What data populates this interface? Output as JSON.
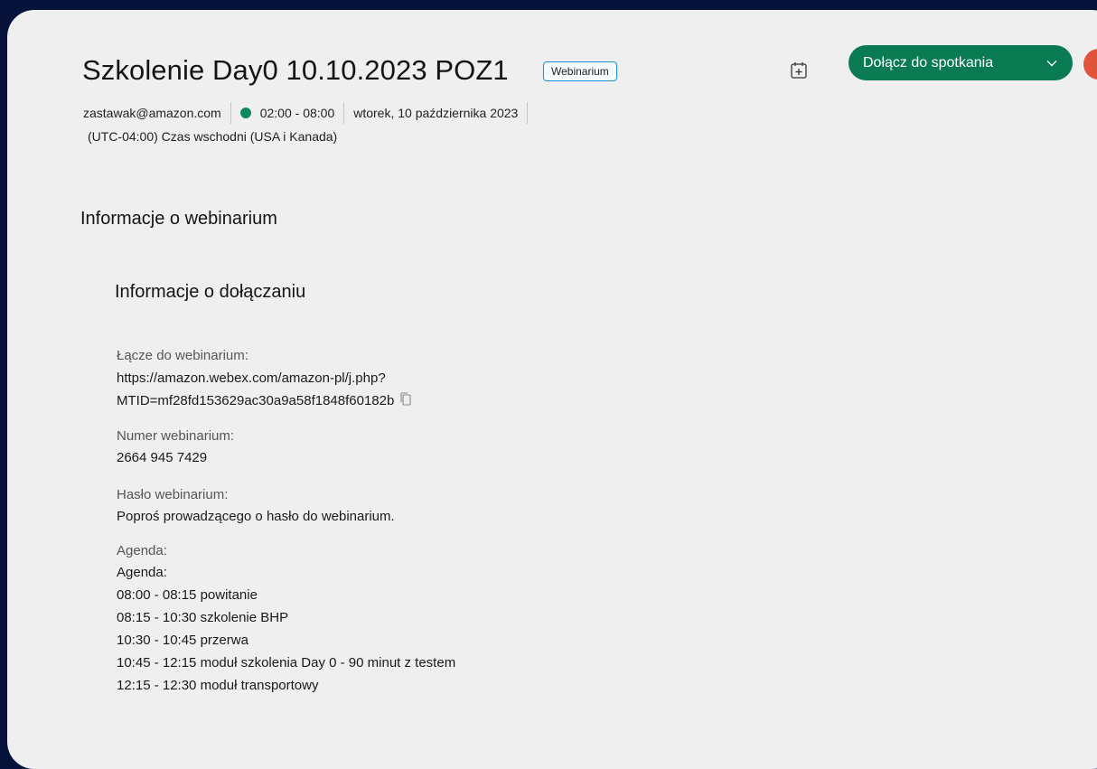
{
  "meeting": {
    "title": "Szkolenie Day0 10.10.2023 POZ1",
    "type_badge": "Webinarium",
    "host_email": "zastawak@amazon.com",
    "time_range": "02:00 - 08:00",
    "date": "wtorek, 10 października 2023",
    "timezone": "(UTC-04:00) Czas wschodni (USA i Kanada)",
    "status_color": "#0a8a5a"
  },
  "actions": {
    "join_label": "Dołącz do spotkania",
    "add_to_calendar_icon": "calendar-add-icon",
    "accent_color": "#0a7a52"
  },
  "sections": {
    "webinar_info_heading": "Informacje o webinarium",
    "join_info_heading": "Informacje o dołączaniu"
  },
  "join_info": {
    "link_label": "Łącze do webinarium:",
    "link_line1": "https://amazon.webex.com/amazon-pl/j.php?",
    "link_line2": "MTID=mf28fd153629ac30a9a58f1848f60182b",
    "number_label": "Numer webinarium:",
    "number_value": "2664 945 7429",
    "password_label": "Hasło webinarium:",
    "password_value": "Poproś prowadzącego o hasło do webinarium.",
    "agenda_label": "Agenda:",
    "agenda_lines": [
      "Agenda:",
      "08:00 - 08:15 powitanie",
      "08:15 - 10:30 szkolenie BHP",
      "10:30 - 10:45 przerwa",
      "10:45 - 12:15 moduł szkolenia Day 0 - 90 minut z testem",
      "12:15 - 12:30 moduł transportowy"
    ]
  }
}
